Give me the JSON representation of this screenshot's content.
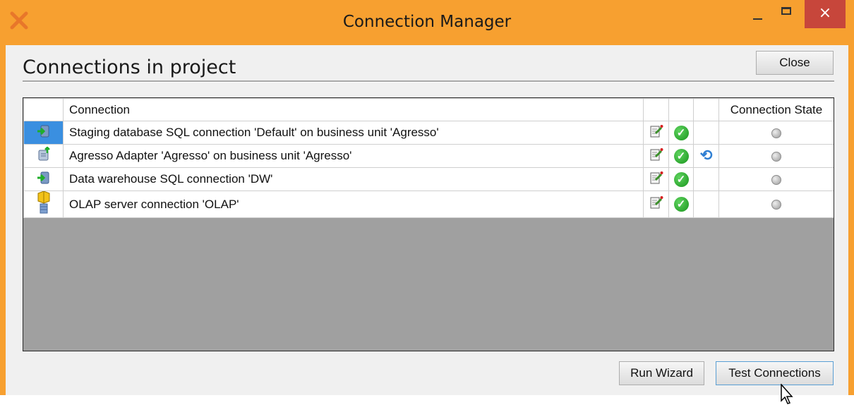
{
  "window": {
    "title": "Connection Manager",
    "close_glyph": "×",
    "accent": "#f7a030"
  },
  "dialog": {
    "heading": "Connections in project",
    "close_label": "Close",
    "run_wizard_label": "Run Wizard",
    "test_connections_label": "Test Connections"
  },
  "grid": {
    "columns": [
      "",
      "Connection",
      "",
      "",
      "",
      "Connection State"
    ],
    "rows": [
      {
        "icon": "database-arrow-icon",
        "connection": "Staging database SQL connection 'Default' on business unit 'Agresso'",
        "has_refresh": false,
        "state": "unknown",
        "selected": true
      },
      {
        "icon": "adapter-upload-icon",
        "connection": "Agresso Adapter 'Agresso' on business unit 'Agresso'",
        "has_refresh": true,
        "state": "unknown",
        "selected": false
      },
      {
        "icon": "database-arrow-icon",
        "connection": "Data warehouse SQL connection 'DW'",
        "has_refresh": false,
        "state": "unknown",
        "selected": false
      },
      {
        "icon": "olap-cube-icon",
        "connection": "OLAP server connection  'OLAP'",
        "has_refresh": false,
        "state": "unknown",
        "selected": false
      }
    ]
  },
  "icons": {
    "edit": "edit-icon",
    "ok": "check-icon",
    "refresh": "refresh-icon",
    "state": "state-indicator-icon"
  },
  "colors": {
    "ok_green": "#18951c",
    "selection_blue": "#3a8fe0",
    "close_red": "#c7463b",
    "grid_empty": "#a0a0a0"
  }
}
